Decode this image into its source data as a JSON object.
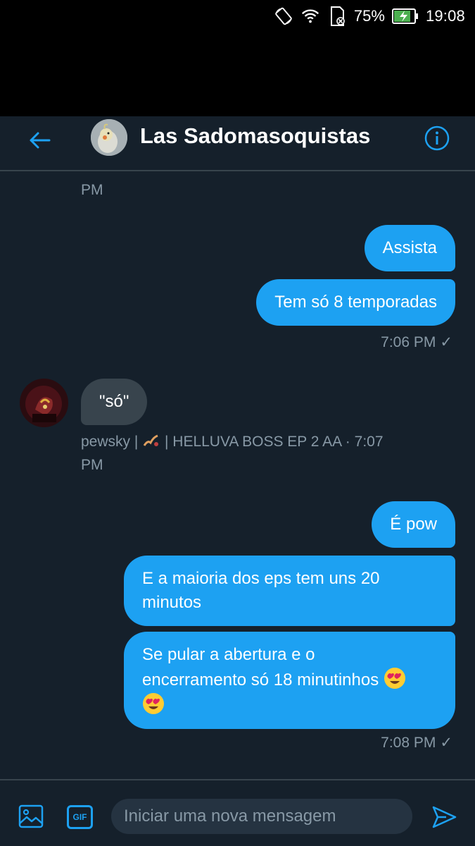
{
  "status_bar": {
    "battery": "75%",
    "time": "19:08",
    "icons": [
      "rotate-icon",
      "wifi-icon",
      "sd-card-icon",
      "battery-charging-icon"
    ]
  },
  "header": {
    "title": "Las Sadomasoquistas",
    "back_icon": "arrow-left-icon",
    "info_icon": "info-icon"
  },
  "conversation": {
    "clipped_meta_tail": "PM",
    "messages": [
      {
        "direction": "out",
        "text": "Assista"
      },
      {
        "direction": "out",
        "text": "Tem só 8 temporadas"
      },
      {
        "direction": "out_meta",
        "time": "7:06 PM",
        "status": "✓"
      },
      {
        "direction": "in",
        "text": "\"só\"",
        "sender": "pewsky | ",
        "sender_suffix": " | HELLUVA BOSS EP 2 AA · 7:07",
        "meta_tail": "PM"
      },
      {
        "direction": "out",
        "text": "É pow"
      },
      {
        "direction": "out",
        "text_line1": "E a maioria dos eps tem uns 20",
        "text_line2": "minutos"
      },
      {
        "direction": "out",
        "text_line1": "Se pular a abertura e o",
        "text_line2": "encerramento só 18 minutinhos"
      },
      {
        "direction": "out_meta",
        "time": "7:08 PM",
        "status": "✓"
      }
    ]
  },
  "composer": {
    "placeholder": "Iniciar uma nova mensagem",
    "gif_label": "GIF"
  },
  "colors": {
    "background": "#15202b",
    "accent": "#1da1f2",
    "bubble_in": "#38444d",
    "muted_text": "#8899a6"
  }
}
